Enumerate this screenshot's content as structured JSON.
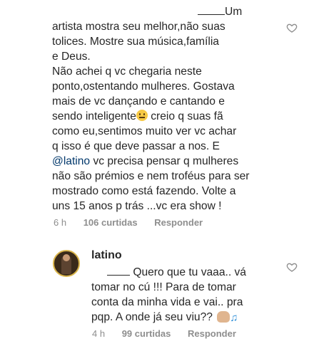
{
  "comment1": {
    "first_line_text": "Um",
    "body_lines": [
      "artista mostra seu melhor,não suas",
      "tolices. Mostre sua música,família",
      "e Deus."
    ],
    "para2_lines_a": [
      "Não achei q vc chegaria neste",
      "ponto,ostentando mulheres. Gostava",
      "mais de vc dançando e cantando e"
    ],
    "line_before_emoji": "sendo inteligente",
    "line_after_emoji": " creio q suas fã",
    "para2_lines_b": [
      "como eu,sentimos muito ver vc achar",
      "q isso é que deve passar a nos. E"
    ],
    "mention": "@latino",
    "after_mention": " vc precisa pensar q mulheres",
    "para3_lines": [
      "não são prémios e nem troféus para ser",
      "mostrado como está fazendo. Volte a",
      "uns 15 anos p trás ...vc era show !"
    ],
    "time": "6 h",
    "likes": "106 curtidas",
    "reply": "Responder",
    "heart_icon": "heart-outline-icon"
  },
  "comment2": {
    "author": "latino",
    "first_line_text": " Quero que tu vaaa.. vá",
    "lines": [
      "tomar no cú !!! Para de tomar",
      "conta da minha vida e vai.. pra"
    ],
    "last_line": "pqp. A onde já seu viu?? ",
    "time": "4 h",
    "likes": "99 curtidas",
    "reply": "Responder",
    "heart_icon": "heart-outline-icon"
  },
  "colors": {
    "text": "#262626",
    "meta": "#8e8e8e",
    "mention": "#00376b"
  }
}
